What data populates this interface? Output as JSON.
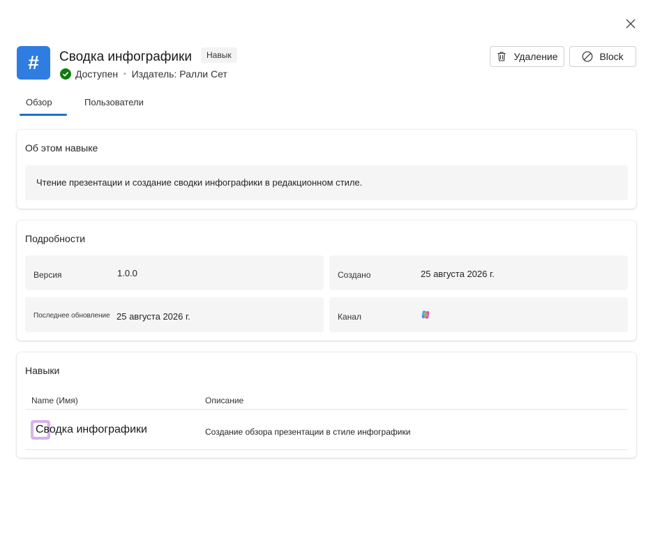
{
  "app": {
    "title": "Сводка инфографики",
    "badge": "Навык",
    "status": "Доступен",
    "publisher": "Издатель: Ралли Сет",
    "icon_glyph": "#",
    "accent": "#2f7de1",
    "status_color": "#107c10"
  },
  "actions": {
    "delete_label": "Удаление",
    "block_label": "Block"
  },
  "tabs": [
    {
      "label": "Обзор",
      "selected": true
    },
    {
      "label": "Пользователи",
      "selected": false
    }
  ],
  "about": {
    "title": "Об этом навыке",
    "description": "Чтение презентации и создание сводки инфографики в редакционном стиле."
  },
  "details": {
    "title": "Подробности",
    "version_label": "Версия",
    "version_value": "1.0.0",
    "created_label": "Создано",
    "created_value": "25 августа 2026 г.",
    "updated_label": "Последнее обновление",
    "updated_value": "25 августа 2026 г.",
    "channel_label": "Канал",
    "channel_icon": "copilot-icon"
  },
  "skills": {
    "title": "Навыки",
    "col_name": "Name (Имя)",
    "col_description": "Описание",
    "rows": [
      {
        "name": "Сводка инфографики",
        "description": "Создание обзора презентации в стиле инфографики"
      }
    ]
  }
}
